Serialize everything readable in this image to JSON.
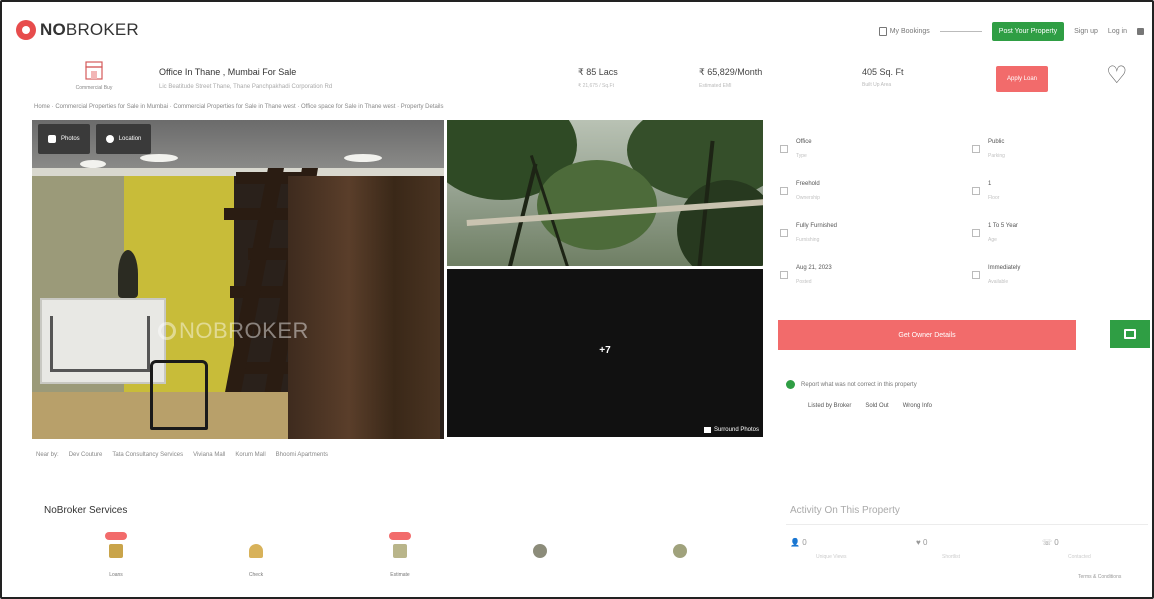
{
  "header": {
    "logo_bold": "NO",
    "logo_rest": "BROKER",
    "my_bookings": "My Bookings",
    "post_property": "Post Your Property",
    "sign_up": "Sign up",
    "log_in": "Log in"
  },
  "property": {
    "category_caption": "Commercial Buy",
    "title": "Office In Thane , Mumbai For Sale",
    "subtitle": "Lic Beatitude Street Thane, Thane Panchpakhadi Corporation Rd",
    "price": "₹ 85 Lacs",
    "price_label": "₹ 21,675 / Sq.Ft",
    "emi": "₹ 65,829/Month",
    "emi_label": "Estimated EMI",
    "area": "405 Sq. Ft",
    "area_label": "Built Up Area",
    "apply_loan": "Apply Loan"
  },
  "breadcrumb": "Home · Commercial Properties for Sale in Mumbai · Commercial Properties for Sale in Thane west · Office space for Sale in Thane west · Property Details",
  "gallery": {
    "photos_btn": "Photos",
    "location_btn": "Location",
    "watermark": "NOBROKER",
    "more_count": "+7",
    "surround": "Surround Photos"
  },
  "details": [
    {
      "value": "Office",
      "label": "Type"
    },
    {
      "value": "Public",
      "label": "Parking"
    },
    {
      "value": "Freehold",
      "label": "Ownership"
    },
    {
      "value": "1",
      "label": "Floor"
    },
    {
      "value": "Fully Furnished",
      "label": "Furnishing"
    },
    {
      "value": "1 To 5 Year",
      "label": "Age"
    },
    {
      "value": "Aug 21, 2023",
      "label": "Posted"
    },
    {
      "value": "Immediately",
      "label": "Available"
    }
  ],
  "contact_btn": "Get Owner Details",
  "report": {
    "text": "Report what was not correct in this property",
    "opts": [
      "Listed by Broker",
      "Sold Out",
      "Wrong Info"
    ]
  },
  "nearby": [
    "Near by:",
    "Dev Couture",
    "Tata Consultancy Services",
    "Viviana Mall",
    "Korum Mall",
    "Bhoomi Apartments"
  ],
  "services": {
    "title": "NoBroker Services",
    "items": [
      {
        "label": "Loans",
        "badge": true
      },
      {
        "label": "Check",
        "badge": false
      },
      {
        "label": "Estimate",
        "badge": true
      },
      {
        "label": "",
        "badge": false
      },
      {
        "label": "",
        "badge": false
      }
    ]
  },
  "activity": {
    "title": "Activity On This Property",
    "items": [
      {
        "value": "0",
        "label": "Unique Views"
      },
      {
        "value": "0",
        "label": "Shortlist"
      },
      {
        "value": "0",
        "label": "Contacted"
      }
    ],
    "footer": "Terms & Conditions"
  },
  "colors": {
    "brand_red": "#f26b6b",
    "green": "#2f9e44"
  }
}
